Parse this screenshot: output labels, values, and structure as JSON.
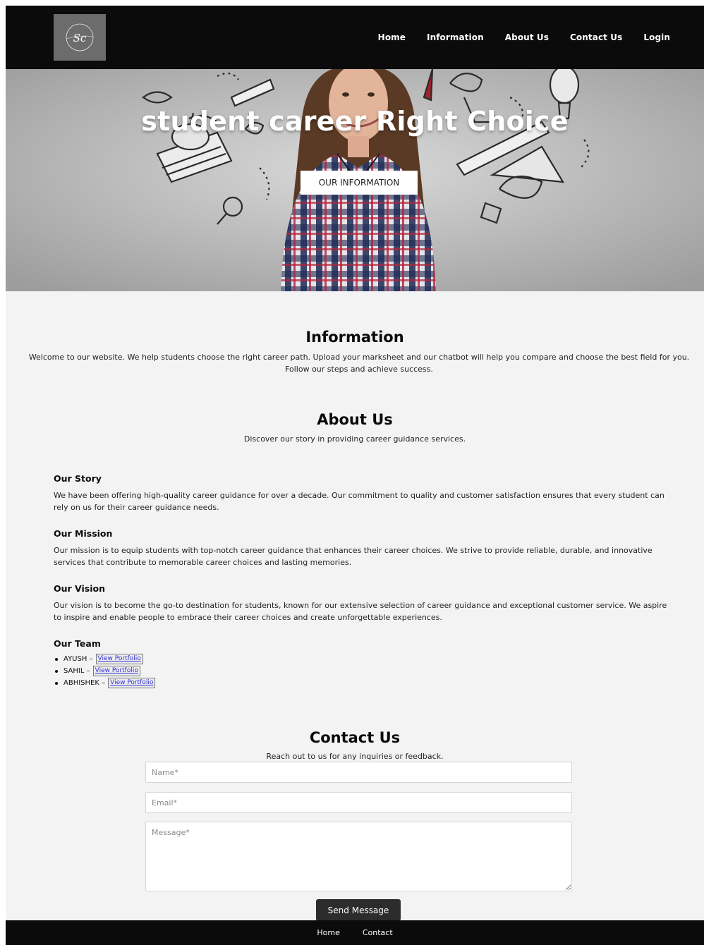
{
  "header": {
    "logo_text": "Sc",
    "nav": [
      "Home",
      "Information",
      "About Us",
      "Contact Us",
      "Login"
    ]
  },
  "hero": {
    "title": "student career Right Choice",
    "button_label": "OUR INFORMATION"
  },
  "information": {
    "title": "Information",
    "line1": "Welcome to our website. We help students choose the right career path. Upload your marksheet and our chatbot will help you compare and choose the best field for you.",
    "line2": "Follow our steps and achieve success."
  },
  "about": {
    "title": "About Us",
    "subtitle": "Discover our story in providing career guidance services.",
    "blocks": [
      {
        "heading": "Our Story",
        "text": "We have been offering high-quality career guidance for over a decade. Our commitment to quality and customer satisfaction ensures that every student can rely on us for their career guidance needs."
      },
      {
        "heading": "Our Mission",
        "text": "Our mission is to equip students with top-notch career guidance that enhances their career choices. We strive to provide reliable, durable, and innovative services that contribute to memorable career choices and lasting memories."
      },
      {
        "heading": "Our Vision",
        "text": "Our vision is to become the go-to destination for students, known for our extensive selection of career guidance and exceptional customer service. We aspire to inspire and enable people to embrace their career choices and create unforgettable experiences."
      }
    ],
    "team": {
      "heading": "Our Team",
      "members": [
        {
          "name": "AYUSH",
          "link": "View Portfolio"
        },
        {
          "name": "SAHIL",
          "link": "View Portfolio"
        },
        {
          "name": "ABHISHEK",
          "link": "View Portfolio"
        }
      ]
    }
  },
  "contact": {
    "title": "Contact Us",
    "subtitle": "Reach out to us for any inquiries or feedback.",
    "name_placeholder": "Name*",
    "email_placeholder": "Email*",
    "message_placeholder": "Message*",
    "send_label": "Send Message"
  },
  "footer": {
    "links": [
      "Home",
      "Contact"
    ]
  },
  "colors": {
    "header_bg": "#0b0b0b",
    "page_bg": "#f3f3f3",
    "button_dark": "#2c2c2c",
    "link_blue": "#2b2bcf"
  }
}
